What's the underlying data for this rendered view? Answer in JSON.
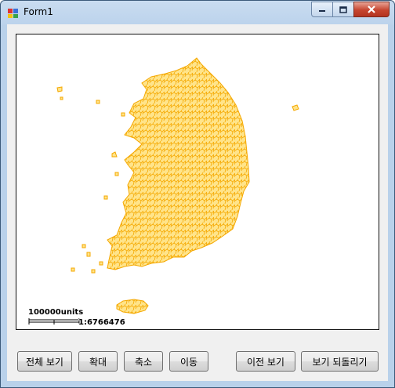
{
  "window": {
    "title": "Form1"
  },
  "map": {
    "fill_color": "#ffe48a",
    "border_color": "#f5a800",
    "scale_units": "100000units",
    "scale_ratio": "1:6766476"
  },
  "buttons": {
    "full_view": "전체 보기",
    "zoom_in": "확대",
    "zoom_out": "축소",
    "pan": "이동",
    "previous_view": "이전 보기",
    "restore_view": "보기 되돌리기"
  }
}
